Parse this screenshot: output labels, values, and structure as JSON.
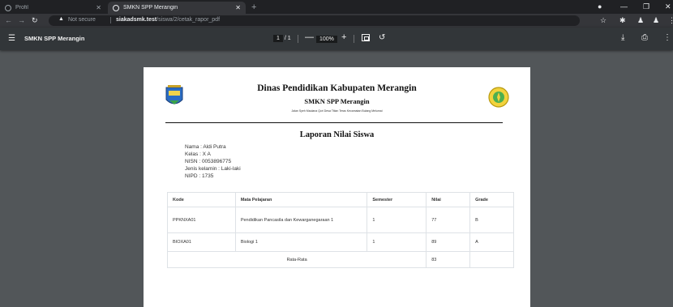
{
  "browser": {
    "tabs": [
      {
        "title": "Profil",
        "active": false
      },
      {
        "title": "SMKN SPP Merangin",
        "active": true
      }
    ],
    "new_tab": "+",
    "address": {
      "security": "Not secure",
      "host": "siakadsmk.test",
      "path": "/siswa/2/cetak_rapor_pdf"
    }
  },
  "pdf_viewer": {
    "title": "SMKN SPP Merangin",
    "page_current": "1",
    "page_total": "/ 1",
    "zoom": "100%",
    "zoom_out": "—",
    "zoom_in": "+"
  },
  "document": {
    "agency": "Dinas Pendidikan Kabupaten Merangin",
    "school": "SMKN SPP Merangin",
    "address": "Jalan Syeh Maulana Qori Desa Titian Teras Kecamatan Bulang Melumai",
    "report_title": "Laporan Nilai Siswa",
    "student": {
      "nama": "Nama : Aldi Putra",
      "kelas": "Kelas : X A",
      "nisn": "NISN : 0053896775",
      "jenis_kelamin": "Jenis kelamin : Laki-laki",
      "nipd": "NIPD : 1735"
    },
    "table": {
      "headers": [
        "Kode",
        "Mata Pelajaran",
        "Semester",
        "Nilai",
        "Grade"
      ],
      "rows": [
        [
          "PPKNXA01",
          "Pendidikan Pancasila dan Kewarganegaraan 1",
          "1",
          "77",
          "B"
        ],
        [
          "BIOXA01",
          "Biologi 1",
          "1",
          "89",
          "A"
        ]
      ],
      "average_label": "Rata-Rata",
      "average_value": "83"
    }
  },
  "colors": {
    "tabstrip": "#202124",
    "toolbar": "#35363a",
    "pdf_toolbar": "#323639",
    "viewer_bg": "#525659",
    "page_bg": "#ffffff"
  }
}
